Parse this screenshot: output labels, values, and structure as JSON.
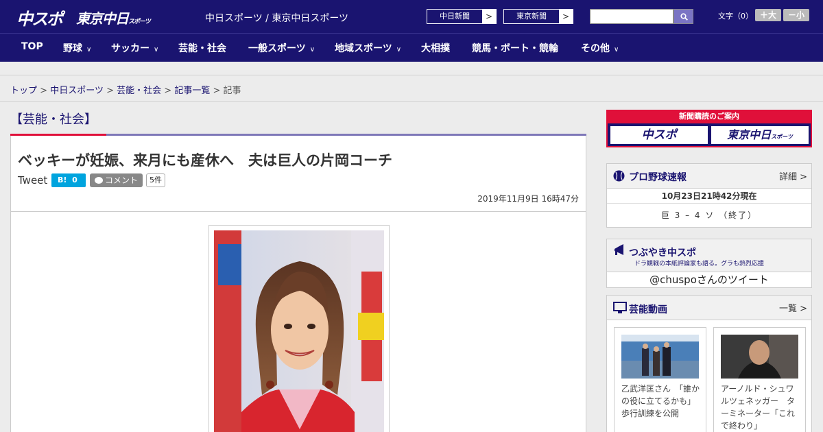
{
  "header": {
    "logo_chuspo": "中スポ",
    "logo_tokyo": "東京中日",
    "logo_tokyo_small": "スポーツ",
    "site_names": "中日スポーツ / 東京中日スポーツ",
    "paper_links": [
      {
        "label": "中日新聞",
        "arrow": ">"
      },
      {
        "label": "東京新聞",
        "arrow": ">"
      }
    ],
    "search_placeholder": "",
    "font_size_label": "文字（0）",
    "font_larger": "＋大",
    "font_smaller": "－小"
  },
  "nav": {
    "items": [
      {
        "label": "TOP",
        "has_menu": false
      },
      {
        "label": "野球",
        "has_menu": true
      },
      {
        "label": "サッカー",
        "has_menu": true
      },
      {
        "label": "芸能・社会",
        "has_menu": false
      },
      {
        "label": "一般スポーツ",
        "has_menu": true
      },
      {
        "label": "地域スポーツ",
        "has_menu": true
      },
      {
        "label": "大相撲",
        "has_menu": false
      },
      {
        "label": "競馬・ボート・競輪",
        "has_menu": false
      },
      {
        "label": "その他",
        "has_menu": true
      }
    ],
    "chevron": "∨"
  },
  "breadcrumb": {
    "items": [
      "トップ",
      "中日スポーツ",
      "芸能・社会",
      "記事一覧"
    ],
    "current": "記事",
    "separator": ">"
  },
  "article": {
    "section": "【芸能・社会】",
    "title": "ベッキーが妊娠、来月にも産休へ　夫は巨人の片岡コーチ",
    "tweet_label": "Tweet",
    "hatena_label": "B!",
    "hatena_count": "0",
    "comment_label": "コメント",
    "comment_count": "5件",
    "date": "2019年11月9日 16時47分"
  },
  "sidebar": {
    "promo": {
      "title": "新聞購読のご案内",
      "button1": "中スポ",
      "button2": "東京中日",
      "button2_small": "スポーツ"
    },
    "baseball": {
      "title": "プロ野球速報",
      "more": "詳細 >",
      "date": "10月23日21時42分現在",
      "score": "巨 3 – 4 ソ （終了）"
    },
    "tsubuyaki": {
      "title": "つぶやき中スポ",
      "subtitle": "ドラ観戦の本紙評論家も語る。グラも熱烈応援",
      "tweets_label": "@chuspoさんのツイート"
    },
    "videos": {
      "title": "芸能動画",
      "more": "一覧 >",
      "items": [
        {
          "caption": "乙武洋匡さん　「誰かの役に立てるかも」歩行訓練を公開"
        },
        {
          "caption": "アーノルド・シュワルツェネッガー　ターミネーター「これで終わり」"
        }
      ]
    }
  },
  "colors": {
    "brand_navy": "#1a1470",
    "accent_red": "#e0103a",
    "hatena_blue": "#00a4de"
  }
}
